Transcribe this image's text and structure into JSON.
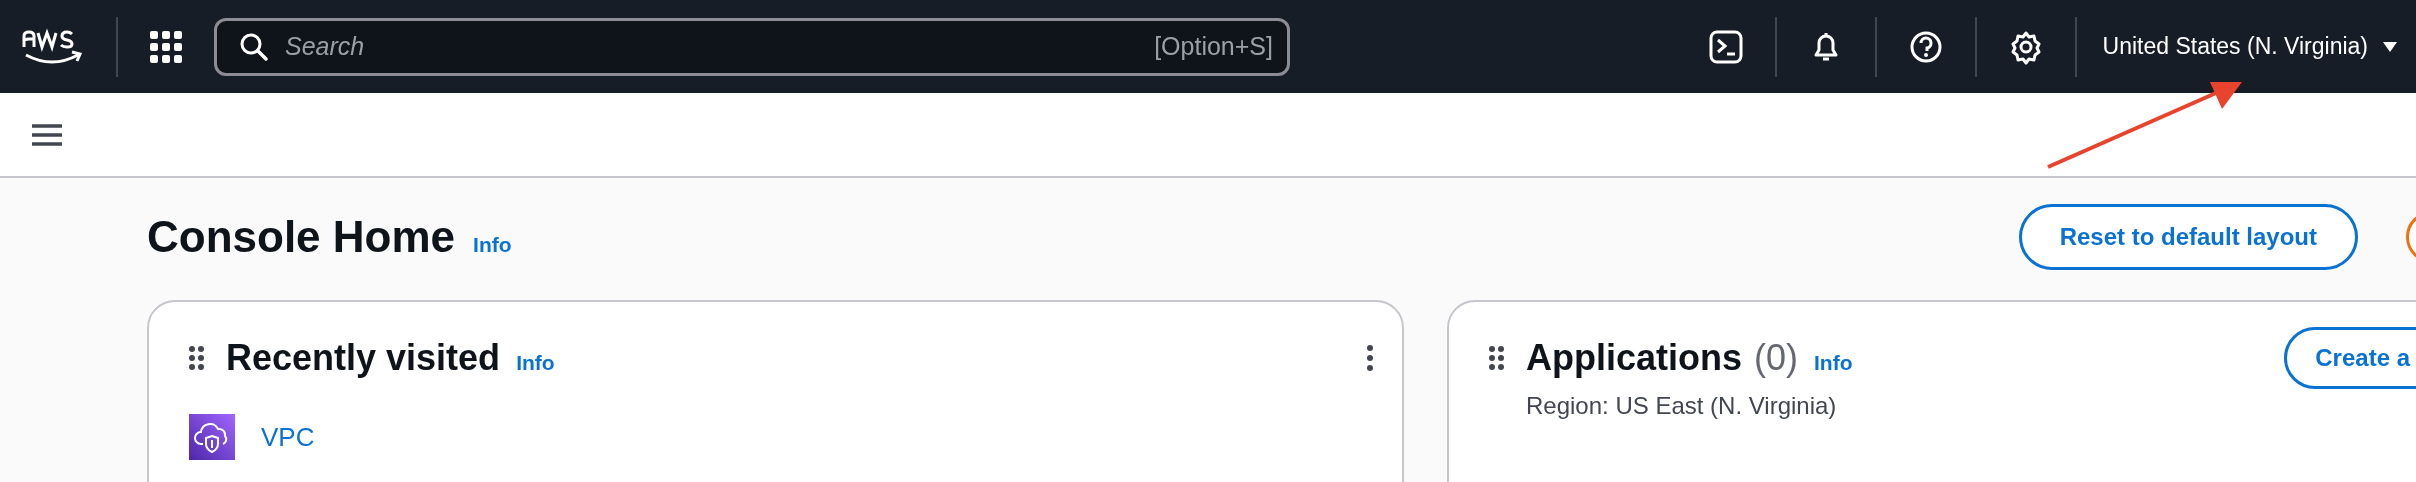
{
  "top_bar": {
    "search": {
      "placeholder": "Search",
      "shortcut": "[Option+S]"
    },
    "region": "United States (N. Virginia)"
  },
  "page": {
    "title": "Console Home",
    "info": "Info",
    "reset_button": "Reset to default layout"
  },
  "widgets": [
    {
      "kind": "recent",
      "title": "Recently visited",
      "info": "Info",
      "items": [
        {
          "label": "VPC"
        }
      ]
    },
    {
      "kind": "applications",
      "title": "Applications",
      "count": "(0)",
      "info": "Info",
      "subtitle": "Region: US East (N. Virginia)",
      "action": "Create a"
    }
  ],
  "annotation": {
    "kind": "arrow"
  }
}
